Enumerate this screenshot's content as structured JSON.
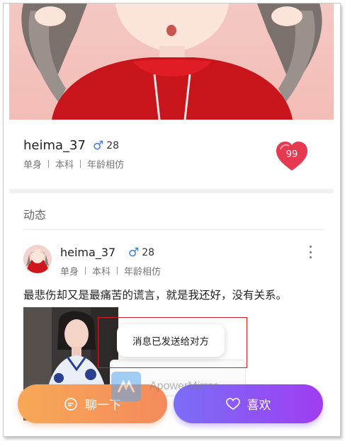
{
  "profile": {
    "username": "heima_37",
    "gender_symbol": "♂",
    "age": "28",
    "tags": [
      "单身",
      "本科",
      "年龄相仿"
    ],
    "likes_count": "99"
  },
  "moments": {
    "section_title": "动态",
    "post": {
      "username": "heima_37",
      "gender_symbol": "♂",
      "age": "28",
      "tags": [
        "单身",
        "本科",
        "年龄相仿"
      ],
      "text": "最悲伤却又是最痛苦的谎言，就是我还好，没有关系。"
    }
  },
  "toast": {
    "message": "消息已发送给对方"
  },
  "actions": {
    "chat_label": "聊一下",
    "like_label": "喜欢"
  },
  "watermark": {
    "text": "ApowerMirror"
  },
  "colors": {
    "chat_gradient_start": "#f7a857",
    "chat_gradient_end": "#f48a5b",
    "like_gradient_start": "#7b6ef6",
    "like_gradient_end": "#9f3df1",
    "heart": "#e53a4f",
    "gender_blue": "#3d7de0",
    "highlight_box": "#d0202a"
  },
  "icons": [
    "heart-icon",
    "male-icon",
    "more-icon",
    "chat-bubble-icon",
    "heart-outline-icon",
    "apowermirror-logo-icon"
  ]
}
